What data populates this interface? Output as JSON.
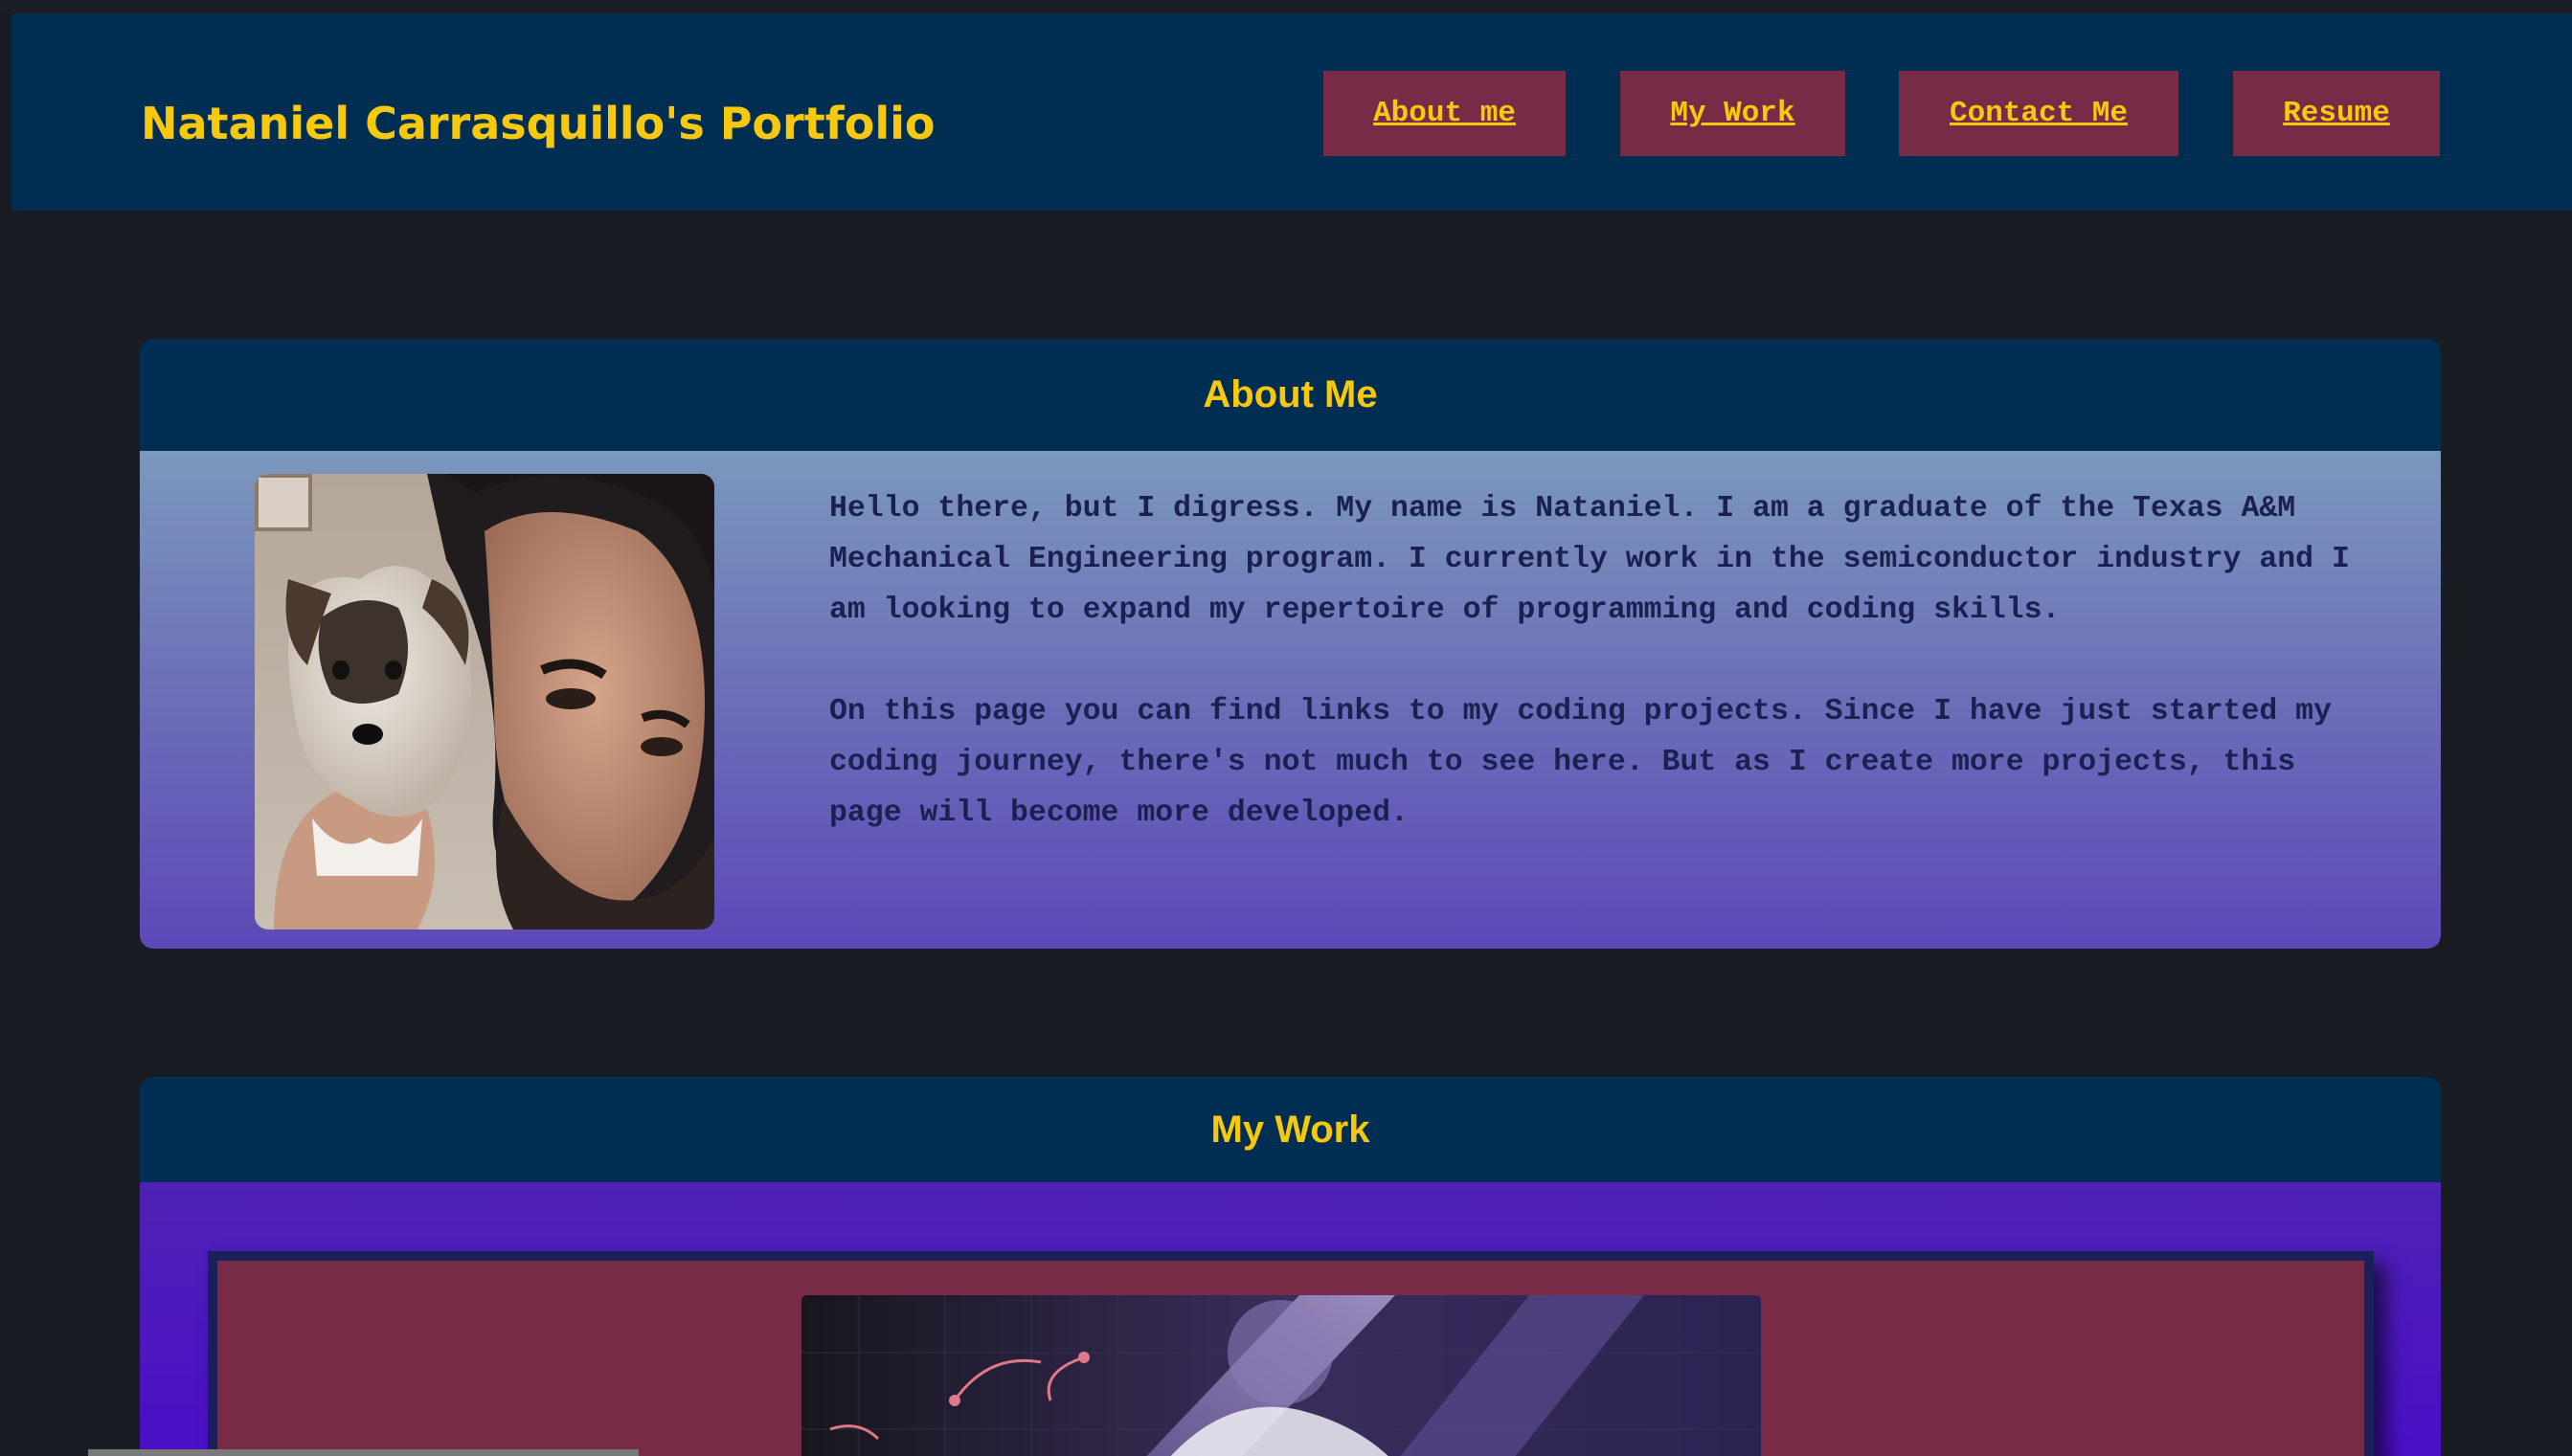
{
  "header": {
    "title": "Nataniel Carrasquillo's Portfolio",
    "nav": [
      {
        "label": "About me"
      },
      {
        "label": "My Work"
      },
      {
        "label": "Contact Me"
      },
      {
        "label": "Resume"
      }
    ]
  },
  "about": {
    "heading": "About Me",
    "paragraphs": [
      "Hello there, but I digress. My name is Nataniel. I am a graduate of the Texas A&M Mechanical Engineering program. I currently work in the semiconductor industry and I am looking to expand my repertoire of programming and coding skills.",
      "On this page you can find links to my coding projects. Since I have just started my coding journey, there's not much to see here. But as I create more projects, this page will become more developed."
    ]
  },
  "work": {
    "heading": "My Work"
  },
  "colors": {
    "header_bg": "#002e52",
    "accent_yellow": "#f6c90e",
    "nav_button_bg": "#782b46",
    "page_bg": "#1a1c24"
  }
}
